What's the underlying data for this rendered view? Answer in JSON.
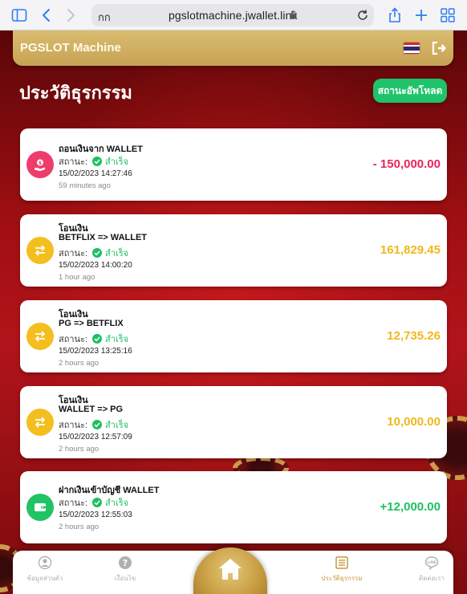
{
  "browser": {
    "aa_label": "กก",
    "url": "pgslotmachine.jwallet.link"
  },
  "header": {
    "brand": "PGSLOT Machine",
    "language_flag": "thailand-flag-icon"
  },
  "page": {
    "title": "ประวัติธุรกรรม",
    "upload_status_button": "สถานะอัพโหลด"
  },
  "transactions": [
    {
      "icon": "dollar-hand-icon",
      "icon_color": "#ee3d6b",
      "lines": [
        "ถอนเงินจาก WALLET"
      ],
      "status_label": "สถานะ:",
      "status_value": "สำเร็จ",
      "datetime": "15/02/2023 14:27:46",
      "ago": "59 minutes ago",
      "amount": "- 150,000.00",
      "amount_color": "#e8245a"
    },
    {
      "icon": "swap-arrows-icon",
      "icon_color": "#f4be1f",
      "lines": [
        "โอนเงิน",
        "BETFLIX => WALLET"
      ],
      "status_label": "สถานะ:",
      "status_value": "สำเร็จ",
      "datetime": "15/02/2023 14:00:20",
      "ago": "1 hour ago",
      "amount": "161,829.45",
      "amount_color": "#f0b81a"
    },
    {
      "icon": "swap-arrows-icon",
      "icon_color": "#f4be1f",
      "lines": [
        "โอนเงิน",
        "PG => BETFLIX"
      ],
      "status_label": "สถานะ:",
      "status_value": "สำเร็จ",
      "datetime": "15/02/2023 13:25:16",
      "ago": "2 hours ago",
      "amount": "12,735.26",
      "amount_color": "#f0b81a"
    },
    {
      "icon": "swap-arrows-icon",
      "icon_color": "#f4be1f",
      "lines": [
        "โอนเงิน",
        "WALLET => PG"
      ],
      "status_label": "สถานะ:",
      "status_value": "สำเร็จ",
      "datetime": "15/02/2023 12:57:09",
      "ago": "2 hours ago",
      "amount": "10,000.00",
      "amount_color": "#f0b81a"
    },
    {
      "icon": "wallet-icon",
      "icon_color": "#22c365",
      "lines": [
        "ฝากเงินเข้าบัญชี WALLET"
      ],
      "status_label": "สถานะ:",
      "status_value": "สำเร็จ",
      "datetime": "15/02/2023 12:55:03",
      "ago": "2 hours ago",
      "amount": "+12,000.00",
      "amount_color": "#1fbf63"
    }
  ],
  "bottom_nav": {
    "profile": "ข้อมูลส่วนตัว",
    "terms": "เงื่อนไข",
    "home_icon": "home-icon",
    "history": "ประวัติธุรกรรม",
    "contact": "ติดต่อเรา"
  },
  "colors": {
    "accent_gold": "#c9a458",
    "success_green": "#1fc36a",
    "background_red": "#a10f12"
  }
}
